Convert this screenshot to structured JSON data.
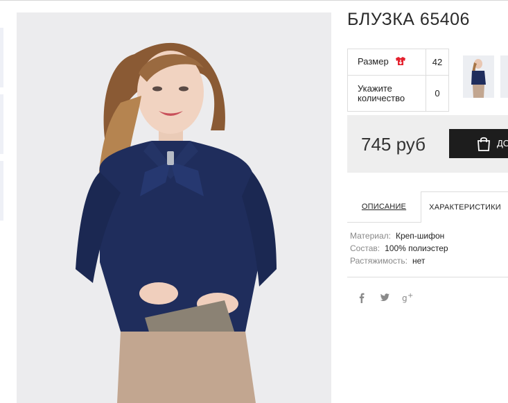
{
  "product": {
    "title": "БЛУЗКА 65406",
    "size_label": "Размер",
    "size_value": "42",
    "quantity_label": "Укажите количество",
    "quantity_value": "0",
    "price": "745 руб",
    "cart_button_label": "ДО"
  },
  "tabs": [
    {
      "label": "ОПИСАНИЕ",
      "active": false
    },
    {
      "label": "ХАРАКТЕРИСТИКИ",
      "active": true
    }
  ],
  "specs": [
    {
      "key": "Материал:",
      "value": "Креп-шифон"
    },
    {
      "key": "Состав:",
      "value": "100% полиэстер"
    },
    {
      "key": "Растяжимость:",
      "value": "нет"
    }
  ],
  "social": [
    "facebook-icon",
    "twitter-icon",
    "google-plus-icon"
  ],
  "colors": {
    "blouse": "#1f2d5c",
    "button": "#1d1d1d",
    "size_icon": "#e4212e"
  }
}
